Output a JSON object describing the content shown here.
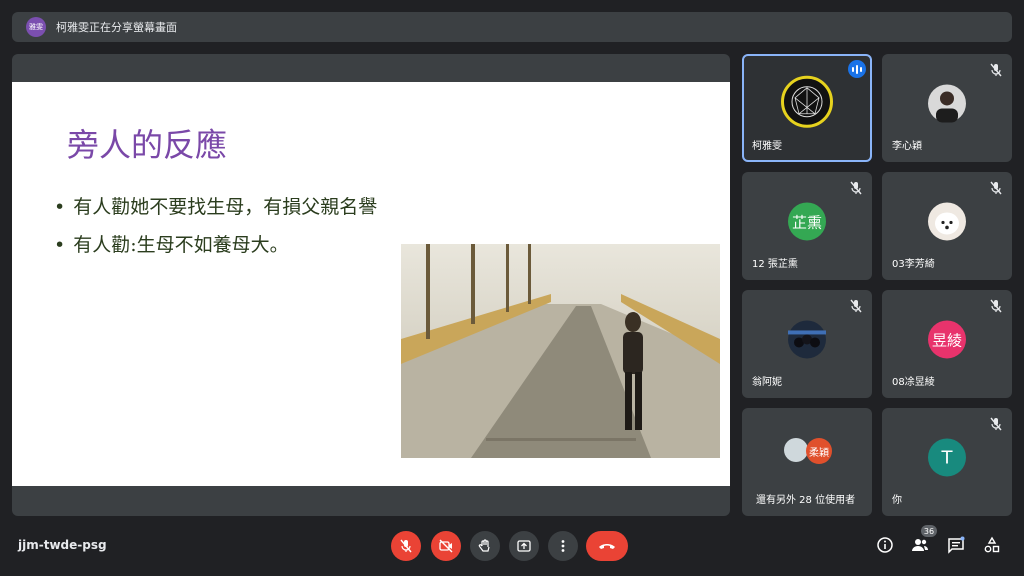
{
  "top_bar": {
    "presenter_badge": "雅雯",
    "title": "柯雅雯正在分享螢幕畫面"
  },
  "slide": {
    "title": "旁人的反應",
    "bullets": [
      "有人勸她不要找生母，有損父親名譽",
      "有人勸:生母不如養母大。"
    ]
  },
  "participants": [
    {
      "name": "柯雅雯",
      "speaking": true
    },
    {
      "name": "李心穎",
      "muted": true
    },
    {
      "name": "12 張芷熏",
      "initials": "芷熏",
      "color": "#34a853",
      "muted": true
    },
    {
      "name": "03李芳綺",
      "muted": true
    },
    {
      "name": "翁阿妮",
      "muted": true
    },
    {
      "name": "08凃昱綾",
      "initials": "昱綾",
      "color": "#e8336c",
      "muted": true
    },
    {
      "name": "還有另外 28 位使用者",
      "stack_initials": "柔穎"
    },
    {
      "name": "你",
      "initials": "T",
      "color": "#188a7e",
      "muted": true
    }
  ],
  "bottom_bar": {
    "meeting_code": "jjm-twde-psg",
    "participant_count": "36",
    "controls": [
      "mic-off",
      "camera-off",
      "raise-hand",
      "present",
      "more",
      "hang-up"
    ],
    "right_icons": [
      "info",
      "people",
      "chat",
      "activities"
    ]
  },
  "colors": {
    "accent": "#8ab4f8",
    "danger": "#ea4335",
    "slide_title": "#7a48a8"
  }
}
